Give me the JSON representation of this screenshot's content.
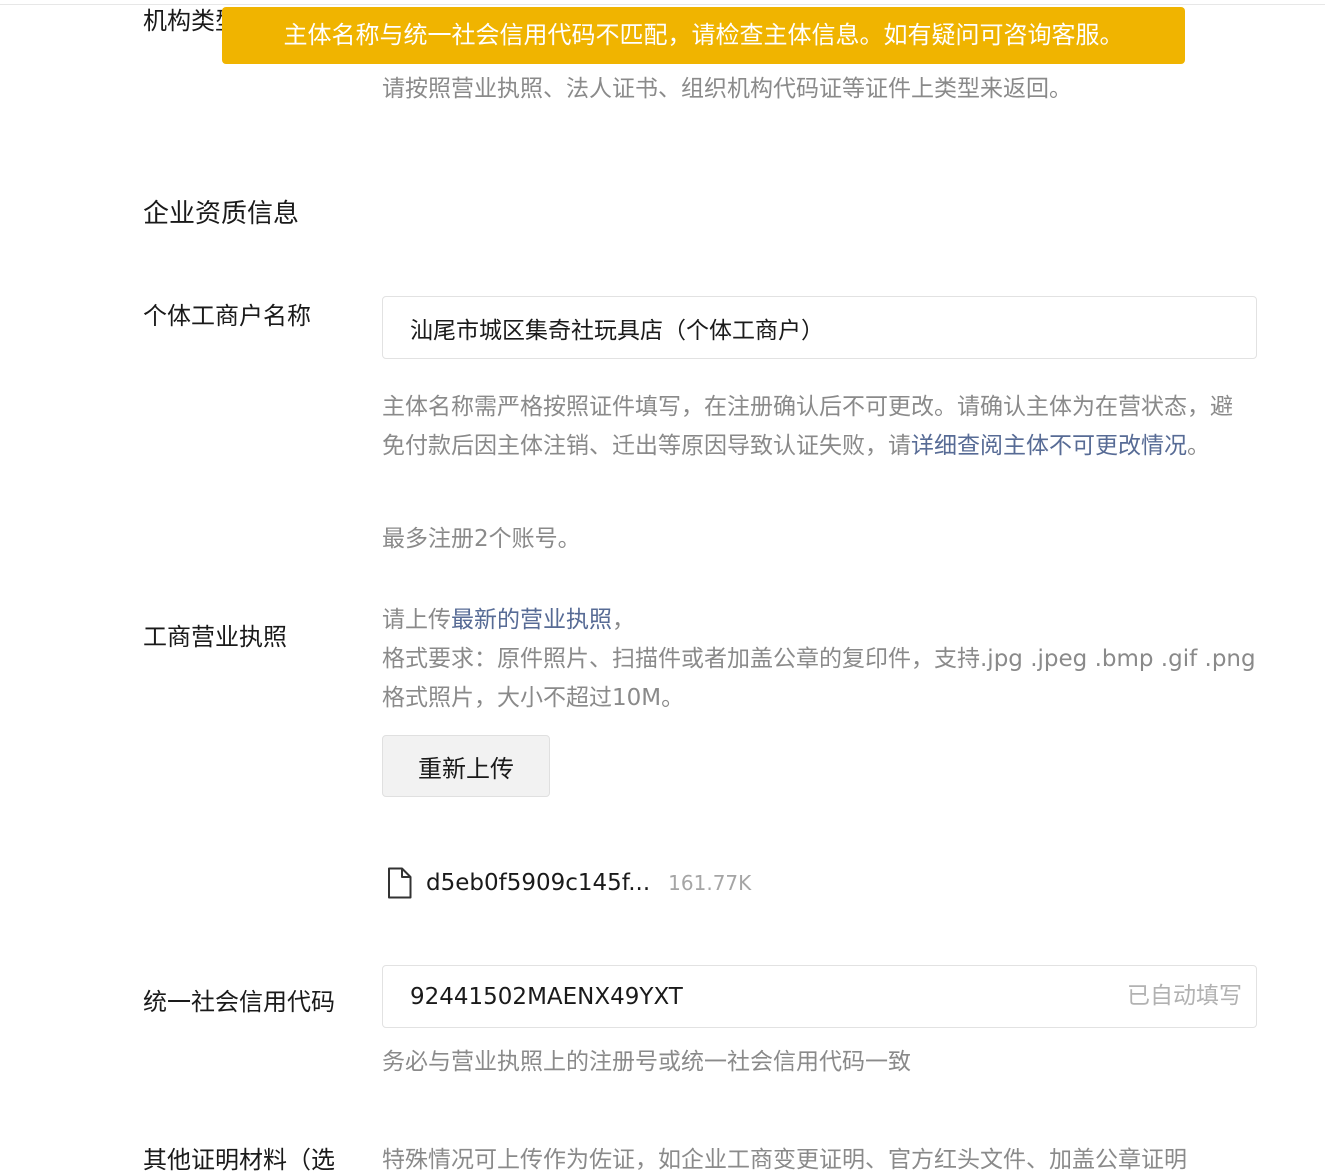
{
  "org_type": {
    "label": "机构类型",
    "hint": "请按照营业执照、法人证书、组织机构代码证等证件上类型来返回。"
  },
  "toast": {
    "message": "主体名称与统一社会信用代码不匹配，请检查主体信息。如有疑问可咨询客服。"
  },
  "section": {
    "title": "企业资质信息"
  },
  "business_name": {
    "label": "个体工商户名称",
    "value": "汕尾市城区集奇社玩具店（个体工商户）",
    "hint_prefix": "主体名称需严格按照证件填写，在注册确认后不可更改。请确认主体为在营状态，避免付款后因主体注销、迁出等原因导致认证失败，请",
    "hint_link": "详细查阅主体不可更改情况",
    "hint_suffix": "。",
    "limit_hint": "最多注册2个账号。"
  },
  "license": {
    "label": "工商营业执照",
    "hint_prefix": "请上传",
    "hint_link": "最新的营业执照",
    "hint_suffix": "，",
    "format_hint": "格式要求：原件照片、扫描件或者加盖公章的复印件，支持.jpg .jpeg .bmp .gif .png格式照片，大小不超过10M。",
    "reupload_label": "重新上传",
    "file_name": "d5eb0f5909c145f...",
    "file_size": "161.77K"
  },
  "credit_code": {
    "label": "统一社会信用代码",
    "value": "92441502MAENX49YXT",
    "suffix": "已自动填写",
    "hint": "务必与营业执照上的注册号或统一社会信用代码一致"
  },
  "other_docs": {
    "label": "其他证明材料（选",
    "hint": "特殊情况可上传作为佐证，如企业工商变更证明、官方红头文件、加盖公章证明"
  }
}
